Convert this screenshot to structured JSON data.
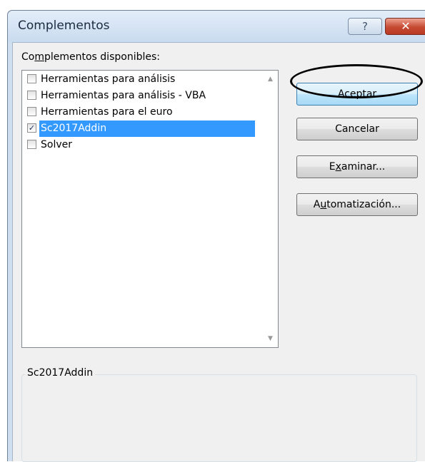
{
  "window": {
    "title": "Complementos",
    "help_glyph": "?",
    "close_glyph": "✕"
  },
  "available_label": {
    "before": "Co",
    "accel": "m",
    "after": "plementos disponibles:"
  },
  "addins": [
    {
      "label": "Herramientas para análisis",
      "checked": false,
      "selected": false
    },
    {
      "label": "Herramientas para análisis - VBA",
      "checked": false,
      "selected": false
    },
    {
      "label": "Herramientas para el euro",
      "checked": false,
      "selected": false
    },
    {
      "label": "Sc2017Addin",
      "checked": true,
      "selected": true
    },
    {
      "label": "Solver",
      "checked": false,
      "selected": false
    }
  ],
  "checkmark_glyph": "✓",
  "scroll": {
    "up_glyph": "▲",
    "down_glyph": "▼"
  },
  "buttons": {
    "accept": {
      "text": "Aceptar"
    },
    "cancel": {
      "text": "Cancelar"
    },
    "browse": {
      "before": "E",
      "accel": "x",
      "after": "aminar..."
    },
    "automation": {
      "before": "A",
      "accel": "u",
      "after": "tomatización..."
    }
  },
  "description": {
    "title": "Sc2017Addin",
    "text": ""
  },
  "colors": {
    "selection": "#3399ff",
    "close_button": "#c64a33",
    "default_button": "#bee6fd"
  }
}
